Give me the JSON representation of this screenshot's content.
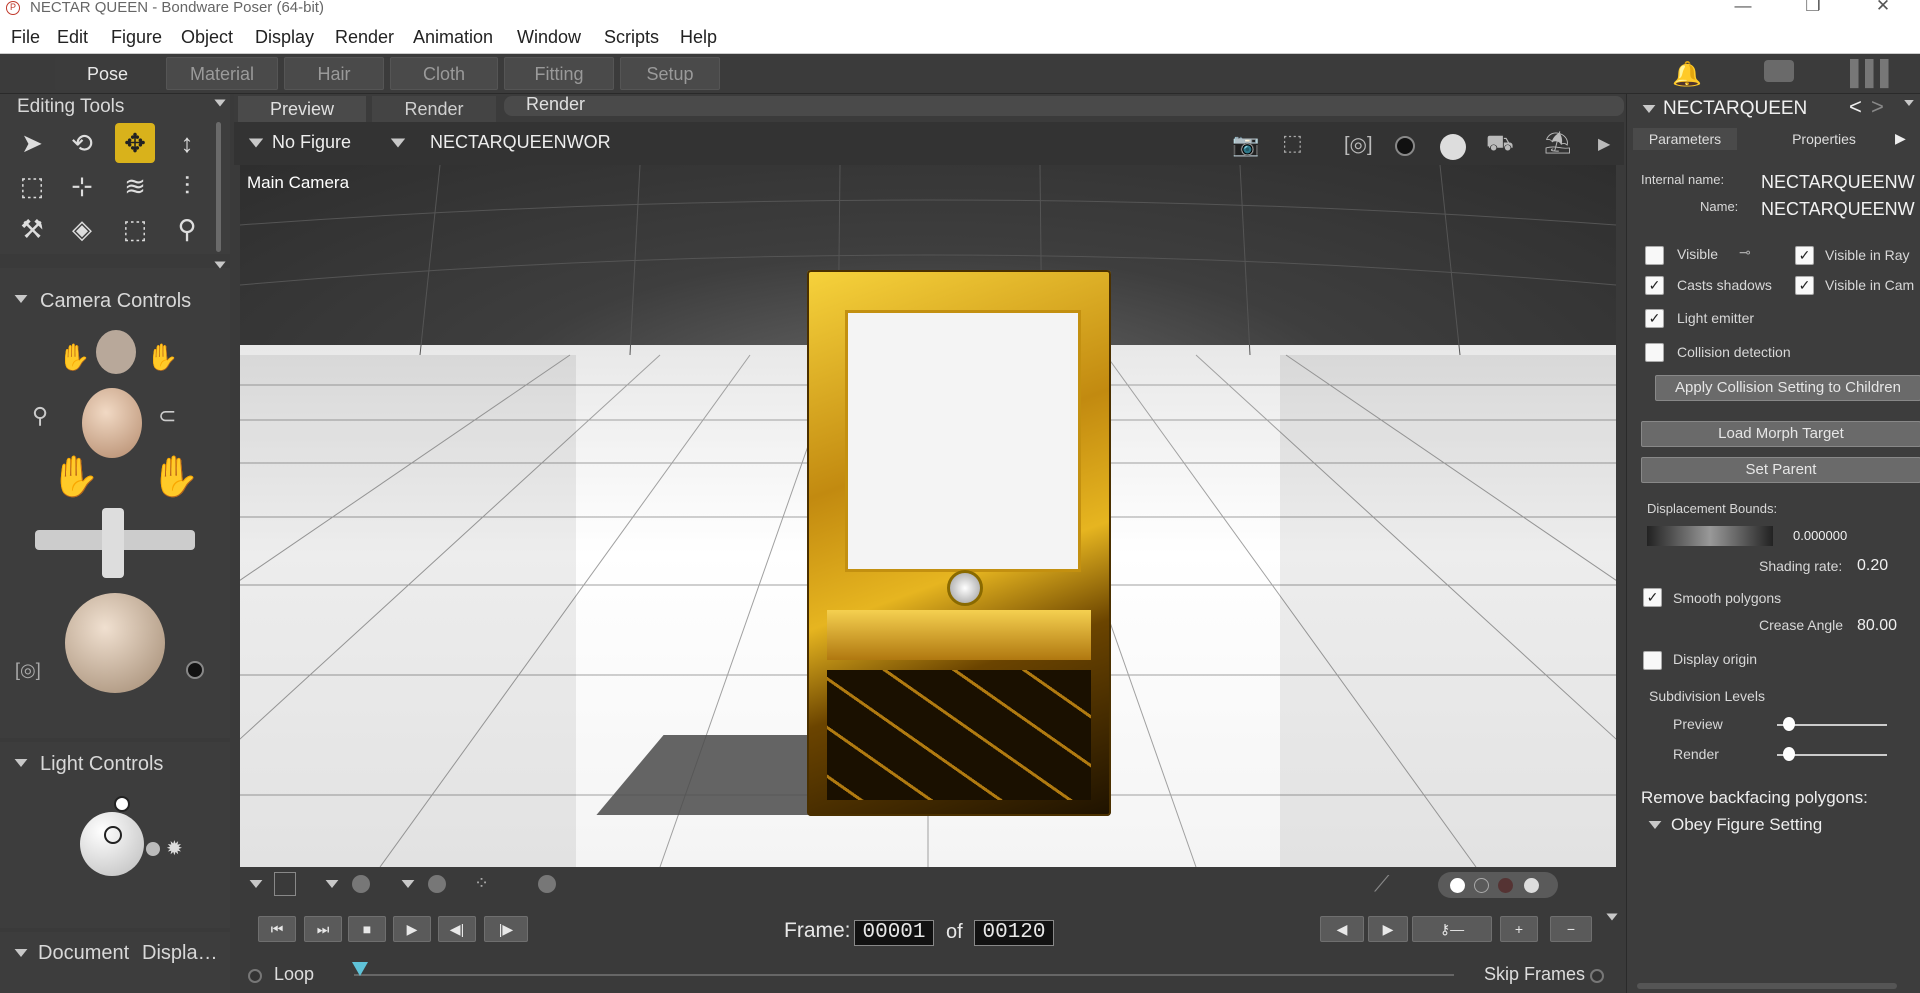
{
  "window": {
    "title": "NECTAR QUEEN - Bondware Poser (64-bit)",
    "minimize_glyph": "—",
    "restore_glyph": "❐",
    "close_glyph": "✕"
  },
  "menu": [
    "File",
    "Edit",
    "Figure",
    "Object",
    "Display",
    "Render",
    "Animation",
    "Window",
    "Scripts",
    "Help"
  ],
  "rooms": [
    "Pose",
    "Material",
    "Hair",
    "Cloth",
    "Fitting",
    "Setup"
  ],
  "right_icons": [
    "bell-icon",
    "chat-icon",
    "library-icon"
  ],
  "editing_tools": {
    "title": "Editing Tools"
  },
  "camera_controls": {
    "title": "Camera Controls"
  },
  "light_controls": {
    "title": "Light Controls"
  },
  "document_display": {
    "title": "Document",
    "title2": "Displa…"
  },
  "document_tabs": [
    "Preview",
    "Render",
    "Render"
  ],
  "viewport": {
    "figure_menu": "No Figure",
    "actor_menu": "NECTARQUEENWOR",
    "camera_label": "Main Camera"
  },
  "playback": {
    "frame_label": "Frame:",
    "frame_value": "00001",
    "of_label": "of",
    "frame_total": "00120",
    "loop_label": "Loop",
    "skip_frames_label": "Skip Frames"
  },
  "properties": {
    "header": "NECTARQUEEN",
    "tabs": [
      "Parameters",
      "Properties"
    ],
    "internal_name_label": "Internal name:",
    "internal_name_value": "NECTARQUEENW",
    "name_label": "Name:",
    "name_value": "NECTARQUEENW",
    "visible_label": "Visible",
    "visible_in_ray_label": "Visible in Ray",
    "casts_shadows_label": "Casts shadows",
    "visible_in_cam_label": "Visible in Cam",
    "light_emitter_label": "Light emitter",
    "collision_label": "Collision detection",
    "apply_collision_button": "Apply Collision Setting to Children",
    "load_morph_button": "Load Morph Target",
    "set_parent_button": "Set Parent",
    "displacement_label": "Displacement Bounds:",
    "displacement_value": "0.000000",
    "shading_rate_label": "Shading rate:",
    "shading_rate_value": "0.20",
    "smooth_polygons_label": "Smooth polygons",
    "crease_angle_label": "Crease Angle",
    "crease_angle_value": "80.00",
    "display_origin_label": "Display origin",
    "subdivision_label": "Subdivision Levels",
    "preview_label": "Preview",
    "render_label": "Render",
    "backfacing_label": "Remove backfacing polygons:",
    "obey_label": "Obey Figure Setting",
    "checked": {
      "visible": false,
      "visible_in_ray": true,
      "casts_shadows": true,
      "visible_in_cam": true,
      "light_emitter": true,
      "collision": false,
      "smooth_polygons": true,
      "display_origin": false
    }
  },
  "colors": {
    "accent": "#d9b21b",
    "panel": "#3d3d3d",
    "viewport_bg": "#3f3f3f"
  }
}
